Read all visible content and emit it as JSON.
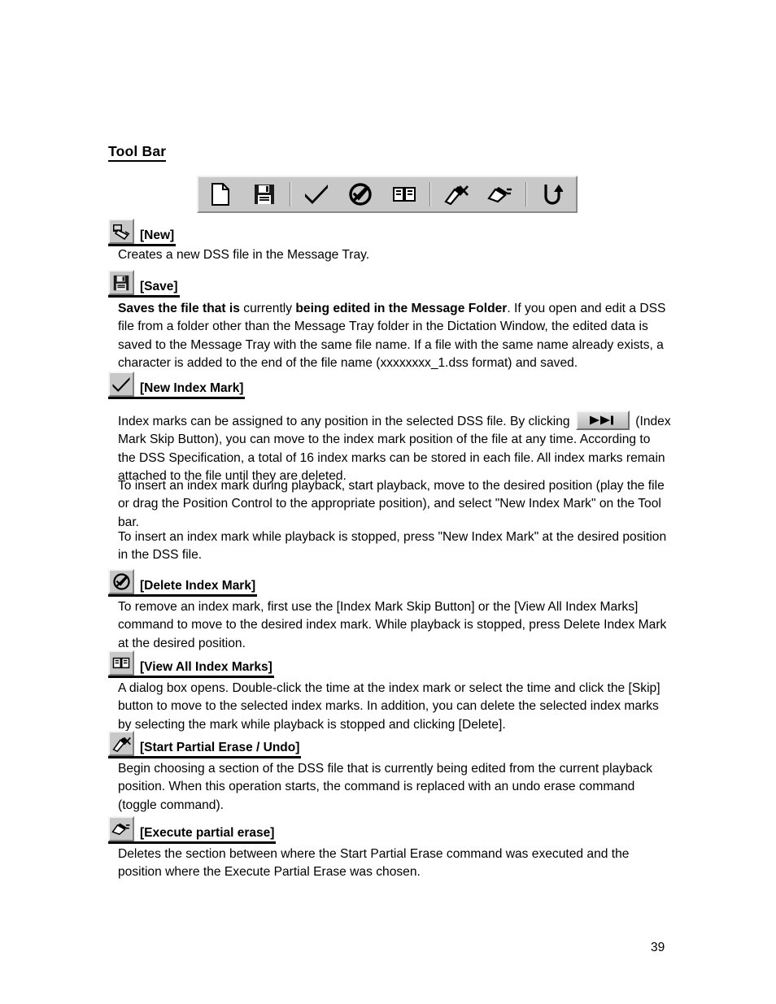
{
  "document": {
    "section_title": "Tool Bar",
    "page_number": "39"
  },
  "toolbar": {
    "name": "Tool Bar",
    "items": [
      {
        "icon": "new-file-icon",
        "label": "New"
      },
      {
        "icon": "save-floppy-icon",
        "label": "Save"
      },
      {
        "icon": "separator",
        "label": ""
      },
      {
        "icon": "check-mark-icon",
        "label": "New Index Mark"
      },
      {
        "icon": "circle-slash-check-icon",
        "label": "Delete Index Mark"
      },
      {
        "icon": "open-book-icon",
        "label": "View All Index Marks"
      },
      {
        "icon": "separator",
        "label": ""
      },
      {
        "icon": "scissors-erase-icon",
        "label": "Start Partial Erase / Undo"
      },
      {
        "icon": "erase-execute-icon",
        "label": "Execute partial erase"
      },
      {
        "icon": "separator",
        "label": ""
      },
      {
        "icon": "u-turn-arrow-icon",
        "label": "Undo"
      }
    ]
  },
  "commands": [
    {
      "id": "new",
      "icon": "new-dss-file-icon",
      "label": "[New]",
      "body": "Creates a new DSS file in the Message Tray."
    },
    {
      "id": "save",
      "icon": "save-floppy-icon",
      "label": "[Save]",
      "body_rich": {
        "part1_bold": "Saves the file that is",
        "part2": " currently ",
        "part3_bold": "being edited in the Message Folder",
        "part4": ".  If you open and edit a DSS file from a folder other than the Message Tray folder in the Dictation Window, the edited data is saved to the Message Tray with the same file name.  If a file with the same name already exists, a character is added to the end of the file name (xxxxxxxx_1.dss format) and saved."
      }
    },
    {
      "id": "new-index-mark",
      "icon": "check-mark-icon",
      "label": "[New Index Mark]",
      "body_part1": "Index marks can be assigned to any position in the selected DSS file.  By clicking",
      "skip_button_icon": "index-mark-skip-button",
      "body_part2": "(Index Mark Skip Button), you can move to the index mark position of the file at any time.  According to the DSS Specification, a total of 16 index marks can be stored in each file.  All index marks remain attached to the file until they are deleted.",
      "body_para2": "To insert an index mark during playback, start playback, move to the desired position (play the file or drag the Position Control to the appropriate position), and select \"New Index Mark\" on the Tool bar.",
      "body_para3": "To insert an index mark while playback is stopped, press \"New Index Mark\" at the desired position in the DSS file."
    },
    {
      "id": "delete-index-mark",
      "icon": "circle-slash-check-icon",
      "label": "[Delete Index Mark]",
      "body": "To remove an index mark, first use the [Index Mark Skip Button] or the [View All Index Marks] command to move to the desired index mark.  While playback is stopped, press Delete Index Mark at the desired position."
    },
    {
      "id": "view-all-index-marks",
      "icon": "open-book-icon",
      "label": "[View All Index Marks]",
      "body": "A dialog box opens.  Double-click the time at the index mark or select the time and click the [Skip] button to move to the selected index marks.  In addition, you can delete the selected index marks by selecting the mark while playback is stopped and clicking [Delete]."
    },
    {
      "id": "start-partial-erase",
      "icon": "scissors-erase-icon",
      "label": "[Start Partial Erase / Undo]",
      "body": "Begin choosing a section of the DSS file that is currently being edited from the current playback position.  When this operation starts, the command is replaced with an undo erase command (toggle command)."
    },
    {
      "id": "execute-partial-erase",
      "icon": "erase-execute-icon",
      "label": "[Execute partial erase]",
      "body": "Deletes the section between where the Start Partial Erase command was executed and the position where the Execute Partial Erase was chosen."
    }
  ],
  "colors": {
    "button_face": "#c8c8c8",
    "button_highlight": "#f4f4f4",
    "button_shadow": "#7e7e7e",
    "text": "#000000",
    "page_background": "#ffffff"
  }
}
